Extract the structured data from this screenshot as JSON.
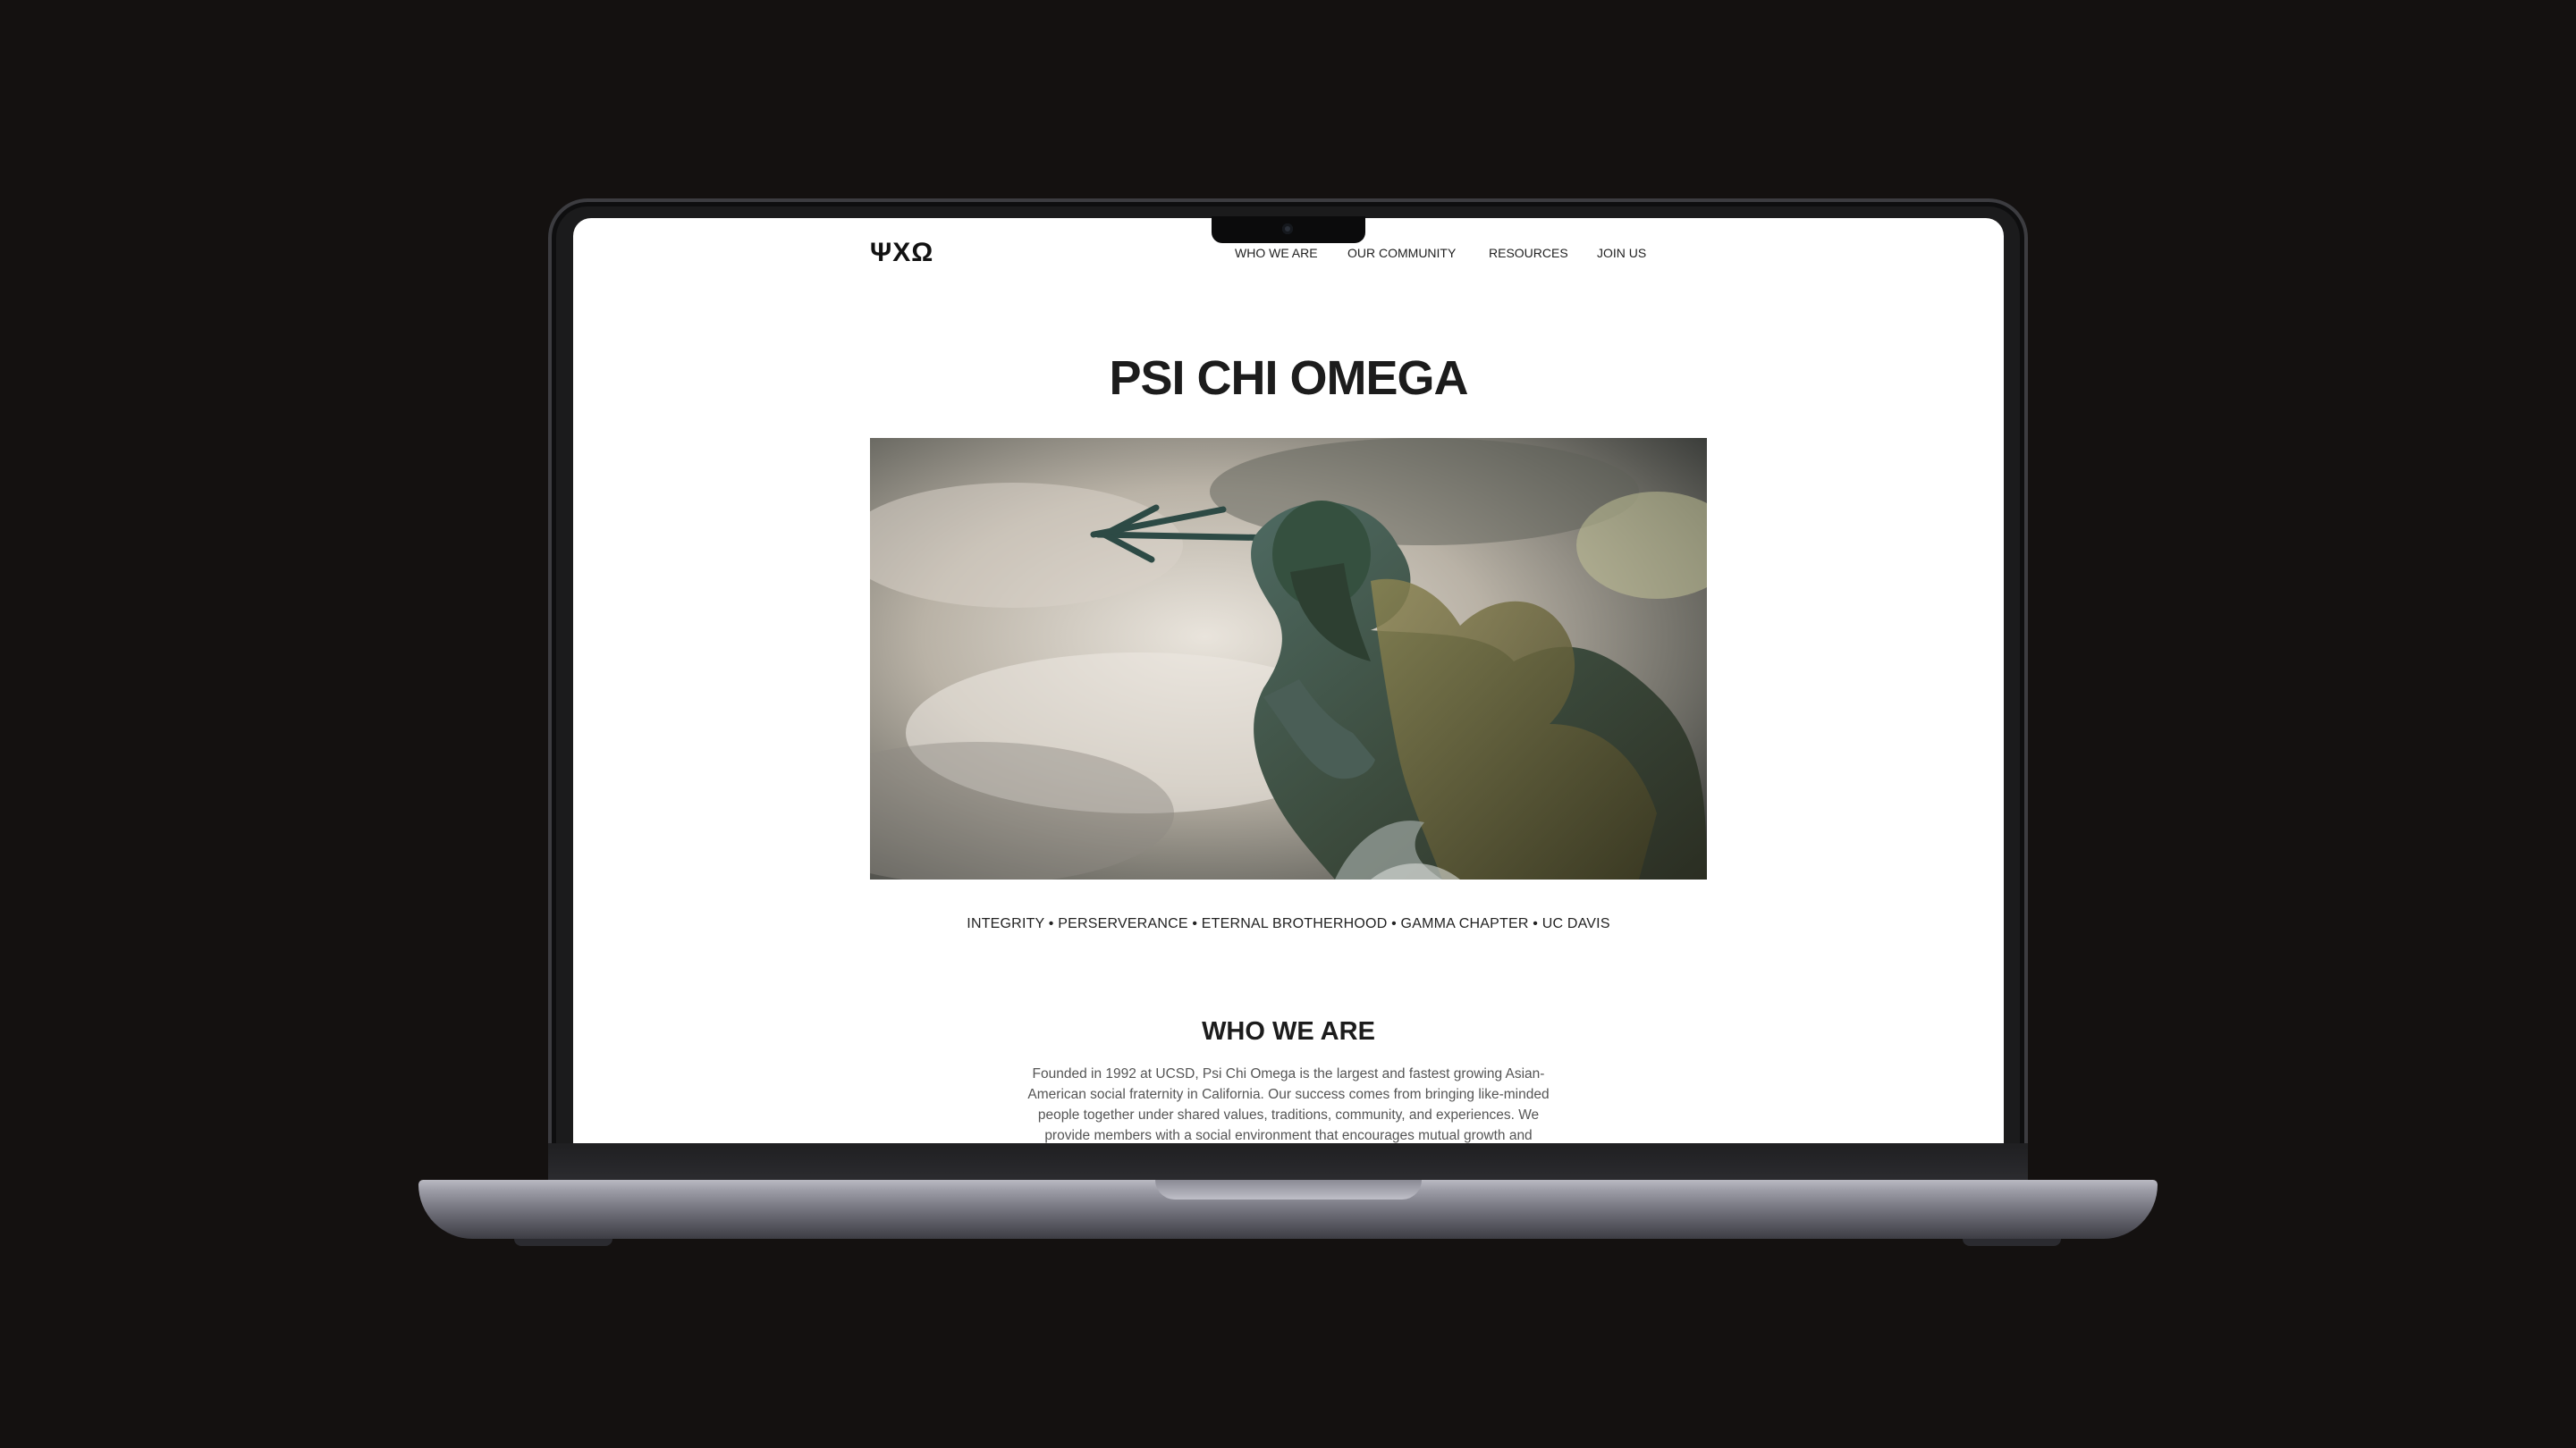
{
  "site": {
    "logo": "ΨΧΩ",
    "nav": [
      {
        "label": "WHO WE ARE"
      },
      {
        "label": "OUR COMMUNITY"
      },
      {
        "label": "RESOURCES"
      },
      {
        "label": "JOIN US"
      }
    ]
  },
  "hero": {
    "title": "PSI CHI OMEGA",
    "image_icon": "statue-of-neptune-with-trident",
    "tagline": "INTEGRITY • PERSERVERANCE • ETERNAL BROTHERHOOD • GAMMA CHAPTER • UC DAVIS"
  },
  "about": {
    "title": "WHO WE ARE",
    "body": "Founded in 1992 at UCSD, Psi Chi Omega is the largest and fastest growing Asian-American social fraternity in California. Our success comes from bringing like-minded people together under shared values, traditions, community, and experiences. We provide members with a social environment that encourages mutual growth and"
  },
  "colors": {
    "background": "#141110",
    "screen": "#ffffff",
    "text": "#1c1c1c"
  }
}
